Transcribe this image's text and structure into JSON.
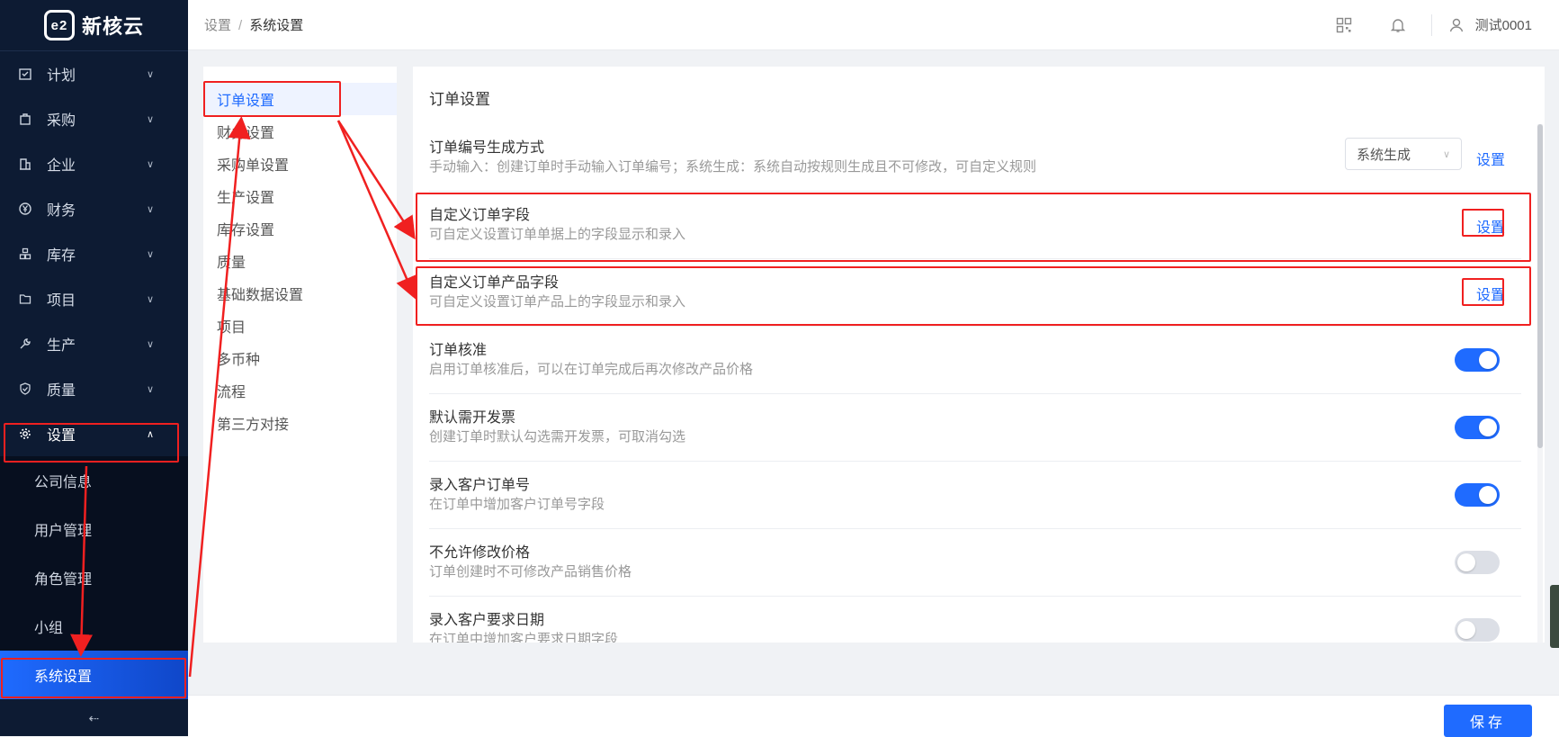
{
  "brand": {
    "logo_text": "e2",
    "name": "新核云"
  },
  "sidebar": {
    "menu": [
      {
        "label": "计划",
        "icon": "calendar-check-icon"
      },
      {
        "label": "采购",
        "icon": "shopping-bag-icon"
      },
      {
        "label": "企业",
        "icon": "building-icon"
      },
      {
        "label": "财务",
        "icon": "yuan-icon"
      },
      {
        "label": "库存",
        "icon": "warehouse-icon"
      },
      {
        "label": "项目",
        "icon": "folder-icon"
      },
      {
        "label": "生产",
        "icon": "wrench-icon"
      },
      {
        "label": "质量",
        "icon": "shield-check-icon"
      },
      {
        "label": "设置",
        "icon": "gear-icon",
        "open": true
      }
    ],
    "submenu": [
      "公司信息",
      "用户管理",
      "角色管理",
      "小组",
      "系统设置"
    ],
    "active_submenu": "系统设置",
    "collapse_label": "⇠"
  },
  "header": {
    "breadcrumb": [
      "设置",
      "系统设置"
    ],
    "breadcrumb_sep": "/",
    "icons": [
      "qrcode-icon",
      "bell-icon",
      "user-icon"
    ],
    "user_name": "测试0001"
  },
  "settings_nav": {
    "items": [
      "订单设置",
      "财务设置",
      "采购单设置",
      "生产设置",
      "库存设置",
      "质量",
      "基础数据设置",
      "项目",
      "多币种",
      "流程",
      "第三方对接"
    ],
    "active": "订单设置"
  },
  "main": {
    "title": "订单设置",
    "rows": [
      {
        "title": "订单编号生成方式",
        "desc": "手动输入：创建订单时手动输入订单编号；系统生成：系统自动按规则生成且不可修改，可自定义规则",
        "control": "select",
        "select_value": "系统生成",
        "link": "设置"
      },
      {
        "title": "自定义订单字段",
        "desc": "可自定义设置订单单据上的字段显示和录入",
        "control": "link",
        "link": "设置"
      },
      {
        "title": "自定义订单产品字段",
        "desc": "可自定义设置订单产品上的字段显示和录入",
        "control": "link",
        "link": "设置"
      },
      {
        "title": "订单核准",
        "desc": "启用订单核准后，可以在订单完成后再次修改产品价格",
        "control": "toggle",
        "on": true
      },
      {
        "title": "默认需开发票",
        "desc": "创建订单时默认勾选需开发票，可取消勾选",
        "control": "toggle",
        "on": true
      },
      {
        "title": "录入客户订单号",
        "desc": "在订单中增加客户订单号字段",
        "control": "toggle",
        "on": true
      },
      {
        "title": "不允许修改价格",
        "desc": "订单创建时不可修改产品销售价格",
        "control": "toggle",
        "on": false
      },
      {
        "title": "录入客户要求日期",
        "desc": "在订单中增加客户要求日期字段",
        "control": "toggle",
        "on": false
      }
    ]
  },
  "footer": {
    "save_label": "保存"
  },
  "annotation": {
    "color": "#f02020"
  }
}
